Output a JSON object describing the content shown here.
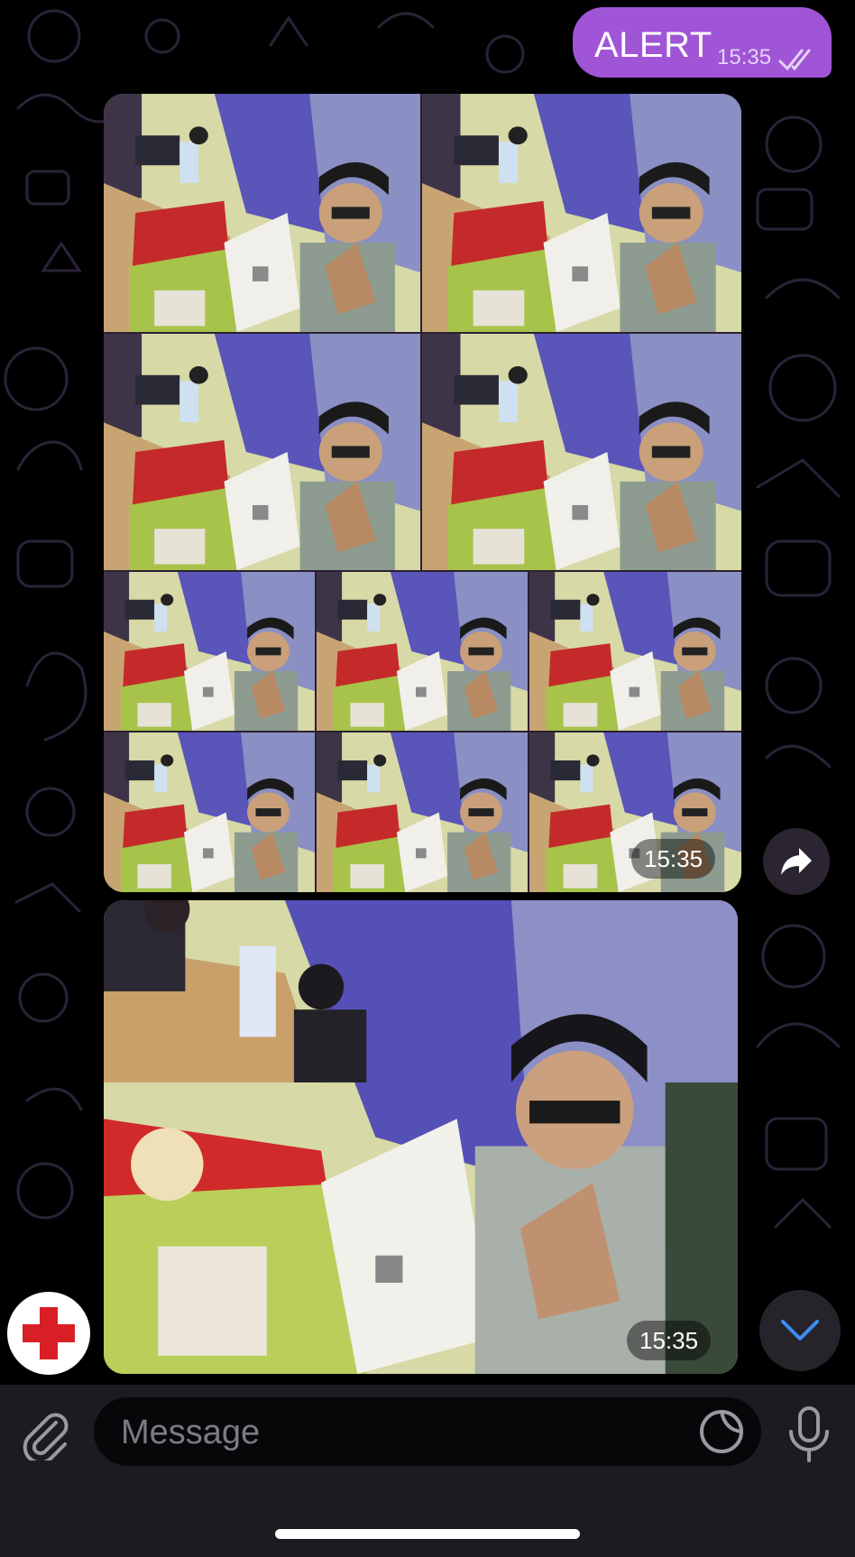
{
  "chat": {
    "outgoing": {
      "text": "ALERT",
      "time": "15:35",
      "status": "read"
    },
    "album": {
      "photo_count": 10,
      "time": "15:35"
    },
    "single_photo": {
      "time": "15:35"
    }
  },
  "composer": {
    "placeholder": "Message"
  },
  "icons": {
    "share": "share-arrow-icon",
    "sos": "red-cross-icon",
    "scroll": "chevron-down-icon",
    "attach": "paperclip-icon",
    "sticker": "sticker-icon",
    "mic": "microphone-icon"
  },
  "colors": {
    "bubble": "#9f55d6",
    "accent_blue": "#3d8cf0",
    "red_cross": "#d91f26"
  }
}
